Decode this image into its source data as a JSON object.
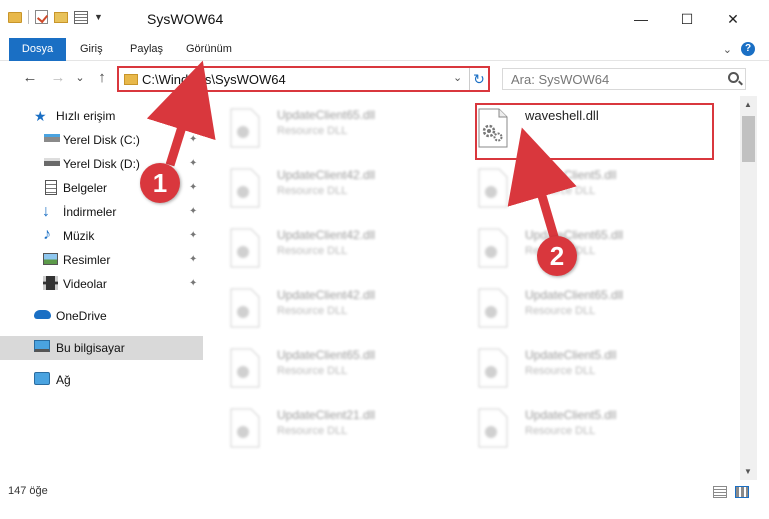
{
  "window": {
    "title": "SysWOW64",
    "minimize_glyph": "—",
    "maximize_glyph": "☐",
    "close_glyph": "✕"
  },
  "ribbon": {
    "tabs": [
      "Dosya",
      "Giriş",
      "Paylaş",
      "Görünüm"
    ],
    "help_glyph": "?",
    "collapse_glyph": "⌄"
  },
  "nav": {
    "back_glyph": "←",
    "forward_glyph": "→",
    "recent_glyph": "⌄",
    "up_glyph": "↑",
    "address": "C:\\Windows\\SysWOW64",
    "address_drop_glyph": "⌄",
    "refresh_glyph": "↻",
    "search_placeholder": "Ara: SysWOW64"
  },
  "sidebar": {
    "items": [
      {
        "label": "Hızlı erişim",
        "icon": "star-icon",
        "pinned": false
      },
      {
        "label": "Yerel Disk (C:)",
        "icon": "drive-icon",
        "pinned": true
      },
      {
        "label": "Yerel Disk (D:)",
        "icon": "drive-icon",
        "pinned": true
      },
      {
        "label": "Belgeler",
        "icon": "documents-icon",
        "pinned": true
      },
      {
        "label": "İndirmeler",
        "icon": "download-icon",
        "pinned": true
      },
      {
        "label": "Müzik",
        "icon": "music-icon",
        "pinned": true
      },
      {
        "label": "Resimler",
        "icon": "pictures-icon",
        "pinned": true
      },
      {
        "label": "Videolar",
        "icon": "video-icon",
        "pinned": true
      },
      {
        "label": "OneDrive",
        "icon": "cloud-icon",
        "pinned": false
      },
      {
        "label": "Bu bilgisayar",
        "icon": "computer-icon",
        "pinned": false,
        "selected": true
      },
      {
        "label": "Ağ",
        "icon": "network-icon",
        "pinned": false
      }
    ],
    "pin_glyph": "📌"
  },
  "files": {
    "left": [
      {
        "name": "UpdateClient65.dll",
        "type": "Resource DLL"
      },
      {
        "name": "UpdateClient42.dll",
        "type": "Resource DLL"
      },
      {
        "name": "UpdateClient42.dll",
        "type": "Resource DLL"
      },
      {
        "name": "UpdateClient42.dll",
        "type": "Resource DLL"
      },
      {
        "name": "UpdateClient65.dll",
        "type": "Resource DLL"
      },
      {
        "name": "UpdateClient21.dll",
        "type": "Resource DLL"
      }
    ],
    "right": [
      {
        "name": "waveshell.dll",
        "type": ""
      },
      {
        "name": "UpdateClient5.dll",
        "type": "Resource DLL"
      },
      {
        "name": "UpdateClient65.dll",
        "type": "Resource DLL"
      },
      {
        "name": "UpdateClient65.dll",
        "type": "Resource DLL"
      },
      {
        "name": "UpdateClient5.dll",
        "type": "Resource DLL"
      },
      {
        "name": "UpdateClient5.dll",
        "type": "Resource DLL"
      }
    ]
  },
  "status": {
    "count": "147 öğe"
  },
  "callouts": [
    "1",
    "2"
  ],
  "colors": {
    "accent": "#1a6fc4",
    "highlight_red": "#d9373d",
    "selected_bg": "#d9d9d9"
  }
}
